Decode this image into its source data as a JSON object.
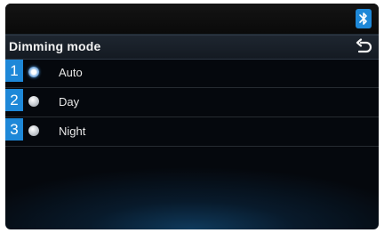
{
  "header": {
    "title": "Dimming mode",
    "back_icon": "back-arrow-icon"
  },
  "status_bar": {
    "icon": "bluetooth-icon"
  },
  "options": [
    {
      "number": "1",
      "label": "Auto",
      "selected": true
    },
    {
      "number": "2",
      "label": "Day",
      "selected": false
    },
    {
      "number": "3",
      "label": "Night",
      "selected": false
    }
  ],
  "colors": {
    "badge": "#1e88d8",
    "background": "#05080d"
  }
}
